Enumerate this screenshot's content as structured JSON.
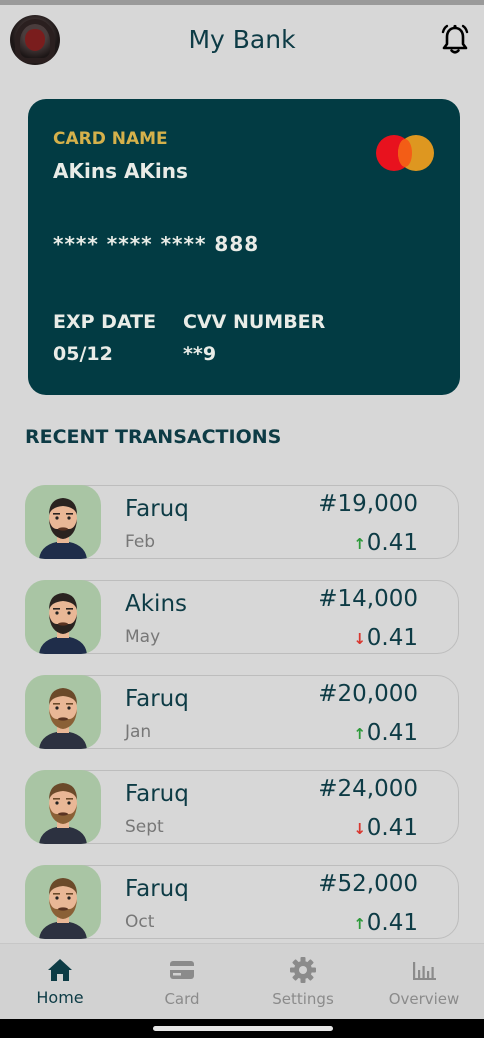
{
  "header": {
    "title": "My Bank"
  },
  "card": {
    "name_label": "CARD NAME",
    "name": "AKins AKins",
    "number": "**** **** **** 888",
    "exp_label": "EXP DATE",
    "exp_value": "05/12",
    "cvv_label": "CVV NUMBER",
    "cvv_value": "**9",
    "brand_colors": {
      "red": "#e8121e",
      "orange": "#f1a01d"
    },
    "background": "#023b43"
  },
  "transactions_title": "RECENT TRANSACTIONS",
  "transactions": [
    {
      "name": "Faruq",
      "month": "Feb",
      "amount": "#19,000",
      "rate": "0.41",
      "trend": "up",
      "arrow": "↑",
      "avatar": "dark-beard-man-avatar"
    },
    {
      "name": "Akins",
      "month": "May",
      "amount": "#14,000",
      "rate": "0.41",
      "trend": "down",
      "arrow": "↓",
      "avatar": "dark-beard-man-avatar"
    },
    {
      "name": "Faruq",
      "month": "Jan",
      "amount": "#20,000",
      "rate": "0.41",
      "trend": "up",
      "arrow": "↑",
      "avatar": "brown-beard-man-avatar"
    },
    {
      "name": "Faruq",
      "month": "Sept",
      "amount": "#24,000",
      "rate": "0.41",
      "trend": "down",
      "arrow": "↓",
      "avatar": "brown-beard-man-avatar"
    },
    {
      "name": "Faruq",
      "month": "Oct",
      "amount": "#52,000",
      "rate": "0.41",
      "trend": "up",
      "arrow": "↑",
      "avatar": "brown-beard-man-avatar"
    }
  ],
  "nav": [
    {
      "label": "Home",
      "icon": "home-icon",
      "active": true
    },
    {
      "label": "Card",
      "icon": "credit-card-icon",
      "active": false
    },
    {
      "label": "Settings",
      "icon": "gear-icon",
      "active": false
    },
    {
      "label": "Overview",
      "icon": "bar-chart-icon",
      "active": false
    }
  ],
  "colors": {
    "primary": "#0d3b45",
    "accent_gold": "#d5b14b",
    "up": "#2d9a3a",
    "down": "#d8362e",
    "avatar_bg": "#a9c5a4"
  }
}
